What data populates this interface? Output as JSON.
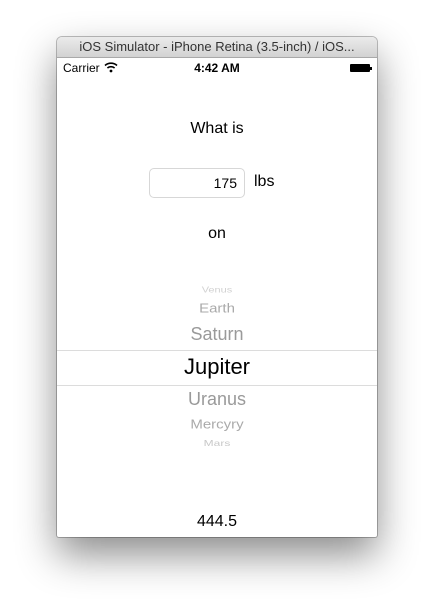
{
  "window": {
    "title": "iOS Simulator - iPhone Retina (3.5-inch) / iOS..."
  },
  "status_bar": {
    "carrier": "Carrier",
    "time": "4:42 AM",
    "wifi_icon": "wifi-icon",
    "battery_icon": "battery-icon"
  },
  "form": {
    "question": "What is",
    "weight_value": "175",
    "unit": "lbs",
    "on_label": "on"
  },
  "picker": {
    "items": [
      "Venus",
      "Earth",
      "Saturn",
      "Jupiter",
      "Uranus",
      "Mercyry",
      "Mars"
    ],
    "selected": "Jupiter"
  },
  "result": {
    "value": "444.5"
  }
}
